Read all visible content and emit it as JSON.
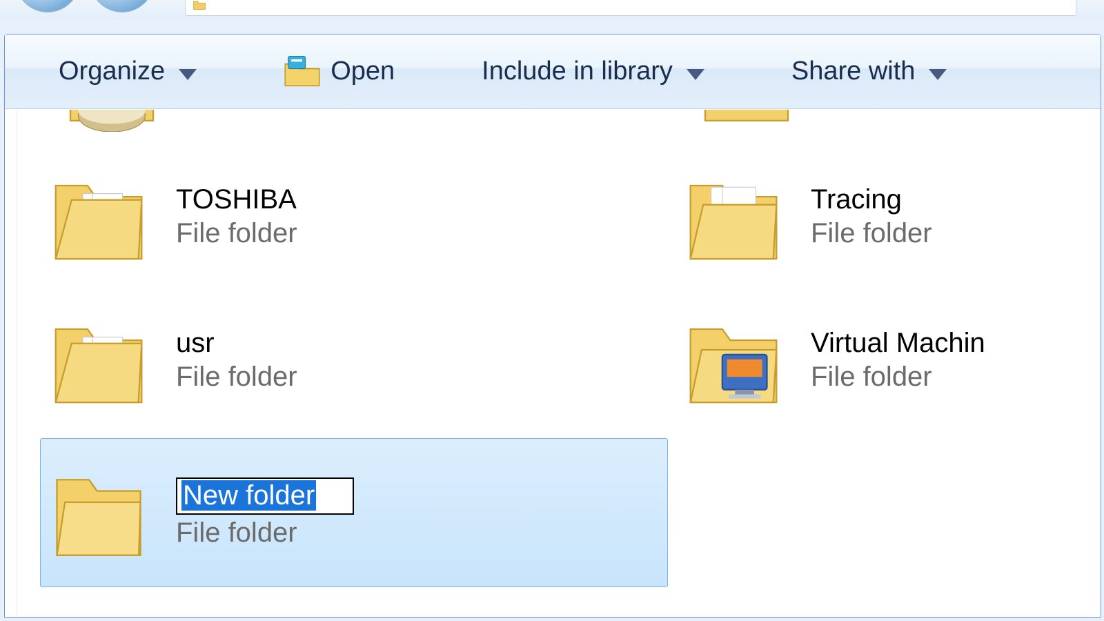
{
  "toolbar": {
    "organize_label": "Organize",
    "open_label": "Open",
    "include_label": "Include in library",
    "share_label": "Share with"
  },
  "items": {
    "col1": [
      {
        "name": "TOSHIBA",
        "type": "File folder",
        "icon": "folder-docs"
      },
      {
        "name": "usr",
        "type": "File folder",
        "icon": "folder-docs"
      }
    ],
    "col2": [
      {
        "name": "Tracing",
        "type": "File folder",
        "icon": "folder-paper"
      },
      {
        "name": "Virtual Machin",
        "type": "File folder",
        "icon": "folder-app"
      }
    ],
    "new_folder": {
      "name": "New folder",
      "type": "File folder",
      "icon": "folder-plain"
    }
  }
}
